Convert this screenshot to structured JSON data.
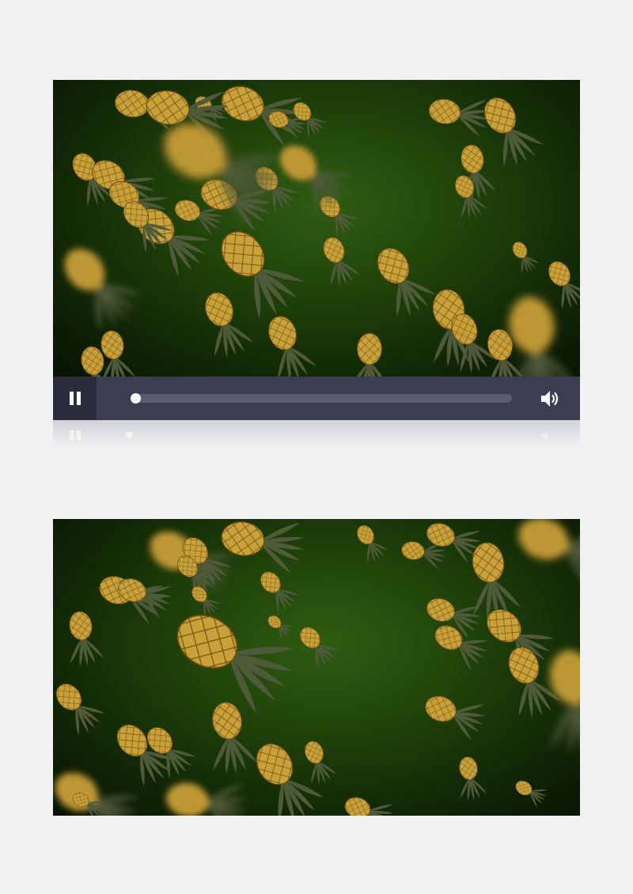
{
  "player": {
    "state": "playing",
    "pause_icon": "pause-icon",
    "volume_icon": "volume-icon",
    "progress_fraction": 0.0,
    "accent_color": "#ffffff",
    "control_bar_color": "#3b3e52",
    "button_bg_color": "#2b2d3c",
    "track_color": "#5a5d72"
  },
  "scene": {
    "subject": "falling-pineapples",
    "background_color": "#1f4209",
    "pineapple_body_color": "#c9a13a",
    "pineapple_leaf_color": "#4f5a3a"
  }
}
